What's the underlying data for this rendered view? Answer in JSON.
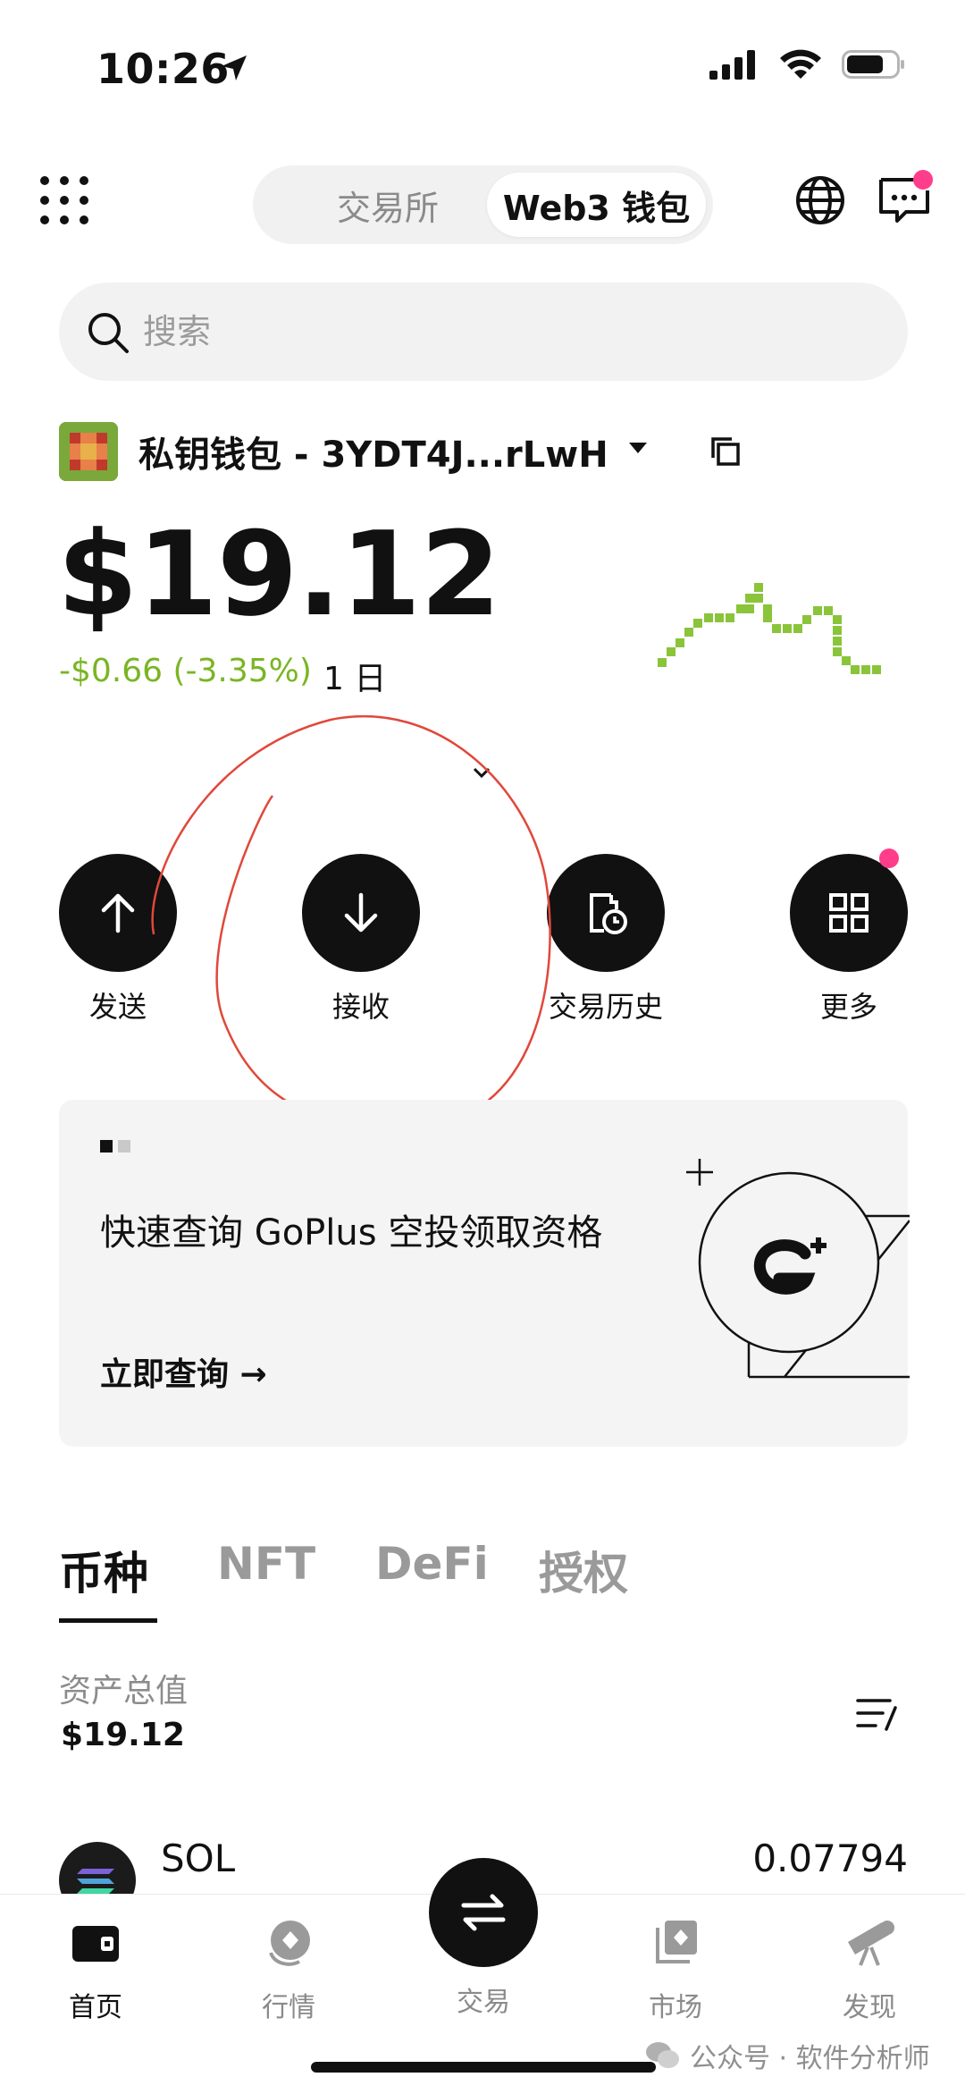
{
  "status_bar": {
    "time": "10:26"
  },
  "header": {
    "tabs": [
      {
        "label": "交易所",
        "active": false
      },
      {
        "label": "Web3 钱包",
        "active": true
      }
    ],
    "accent_badge_color": "#ff3d8b"
  },
  "search": {
    "placeholder": "搜索"
  },
  "wallet": {
    "name": "私钥钱包 - 3YDT4J...rLwH",
    "balance": "$19.12",
    "change": "-$0.66 (-3.35%)",
    "period": "1 日",
    "change_color": "#7ab524"
  },
  "actions": [
    {
      "label": "发送",
      "icon": "arrow-up-icon"
    },
    {
      "label": "接收",
      "icon": "arrow-down-icon"
    },
    {
      "label": "交易历史",
      "icon": "history-icon"
    },
    {
      "label": "更多",
      "icon": "grid-apps-icon"
    }
  ],
  "banner": {
    "title": "快速查询 GoPlus 空投领取资格",
    "cta": "立即查询 →"
  },
  "asset_tabs": [
    {
      "label": "币种",
      "active": true
    },
    {
      "label": "NFT",
      "active": false
    },
    {
      "label": "DeFi",
      "active": false
    },
    {
      "label": "授权",
      "active": false
    }
  ],
  "assets": {
    "total_label": "资产总值",
    "total_value": "$19.12",
    "rows": [
      {
        "symbol": "SOL",
        "amount": "0.07794"
      }
    ]
  },
  "bottom_nav": [
    {
      "label": "首页",
      "icon": "wallet-icon",
      "active": true
    },
    {
      "label": "行情",
      "icon": "market-icon",
      "active": false
    },
    {
      "label": "交易",
      "icon": "swap-icon",
      "active": false
    },
    {
      "label": "市场",
      "icon": "nft-market-icon",
      "active": false
    },
    {
      "label": "发现",
      "icon": "telescope-icon",
      "active": false
    }
  ],
  "watermark": "公众号 · 软件分析师"
}
